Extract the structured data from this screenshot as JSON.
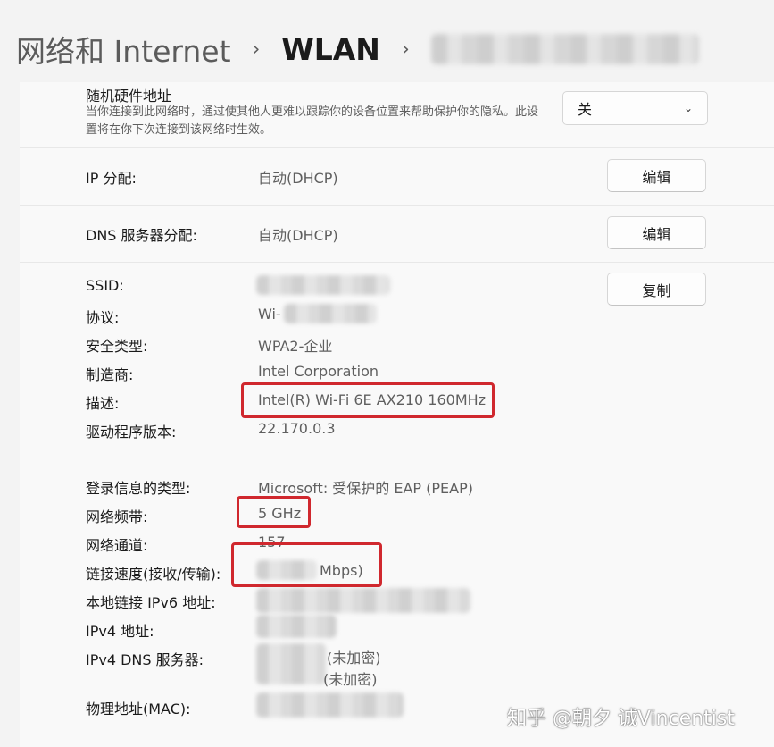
{
  "breadcrumb": {
    "parent": "网络和 Internet",
    "separator": "›",
    "current": "WLAN"
  },
  "random_hw": {
    "title": "随机硬件地址",
    "description": "当你连接到此网络时，通过使其他人更难以跟踪你的设备位置来帮助保护你的隐私。此设置将在你下次连接到该网络时生效。",
    "select_value": "关",
    "chevron_icon": "chevron-down-icon"
  },
  "ip_assign": {
    "label": "IP 分配:",
    "value": "自动(DHCP)",
    "button": "编辑"
  },
  "dns_assign": {
    "label": "DNS 服务器分配:",
    "value": "自动(DHCP)",
    "button": "编辑"
  },
  "copy_button": "复制",
  "properties": {
    "ssid_label": "SSID:",
    "protocol_label": "协议:",
    "protocol_value_prefix": "Wi-",
    "security_label": "安全类型:",
    "security_value": "WPA2-企业",
    "manufacturer_label": "制造商:",
    "manufacturer_value": "Intel Corporation",
    "description_label": "描述:",
    "description_value": "Intel(R) Wi-Fi 6E AX210 160MHz",
    "driver_label": "驱动程序版本:",
    "driver_value": "22.170.0.3",
    "login_type_label": "登录信息的类型:",
    "login_type_value": "Microsoft: 受保护的 EAP (PEAP)",
    "band_label": "网络频带:",
    "band_value": "5 GHz",
    "channel_label": "网络通道:",
    "channel_value": "157",
    "speed_label": "链接速度(接收/传输):",
    "speed_value_suffix": "Mbps)",
    "ipv6_label": "本地链接 IPv6 地址:",
    "ipv4_label": "IPv4 地址:",
    "dns_label": "IPv4 DNS 服务器:",
    "dns_value_1_suffix": "(未加密)",
    "dns_value_2_suffix": "(未加密)",
    "mac_label": "物理地址(MAC):"
  },
  "watermark": "知乎 @朝夕 诚Vincentist",
  "colors": {
    "highlight": "#d0282e",
    "background": "#f3f3f3",
    "panel": "#f9f9f9"
  }
}
